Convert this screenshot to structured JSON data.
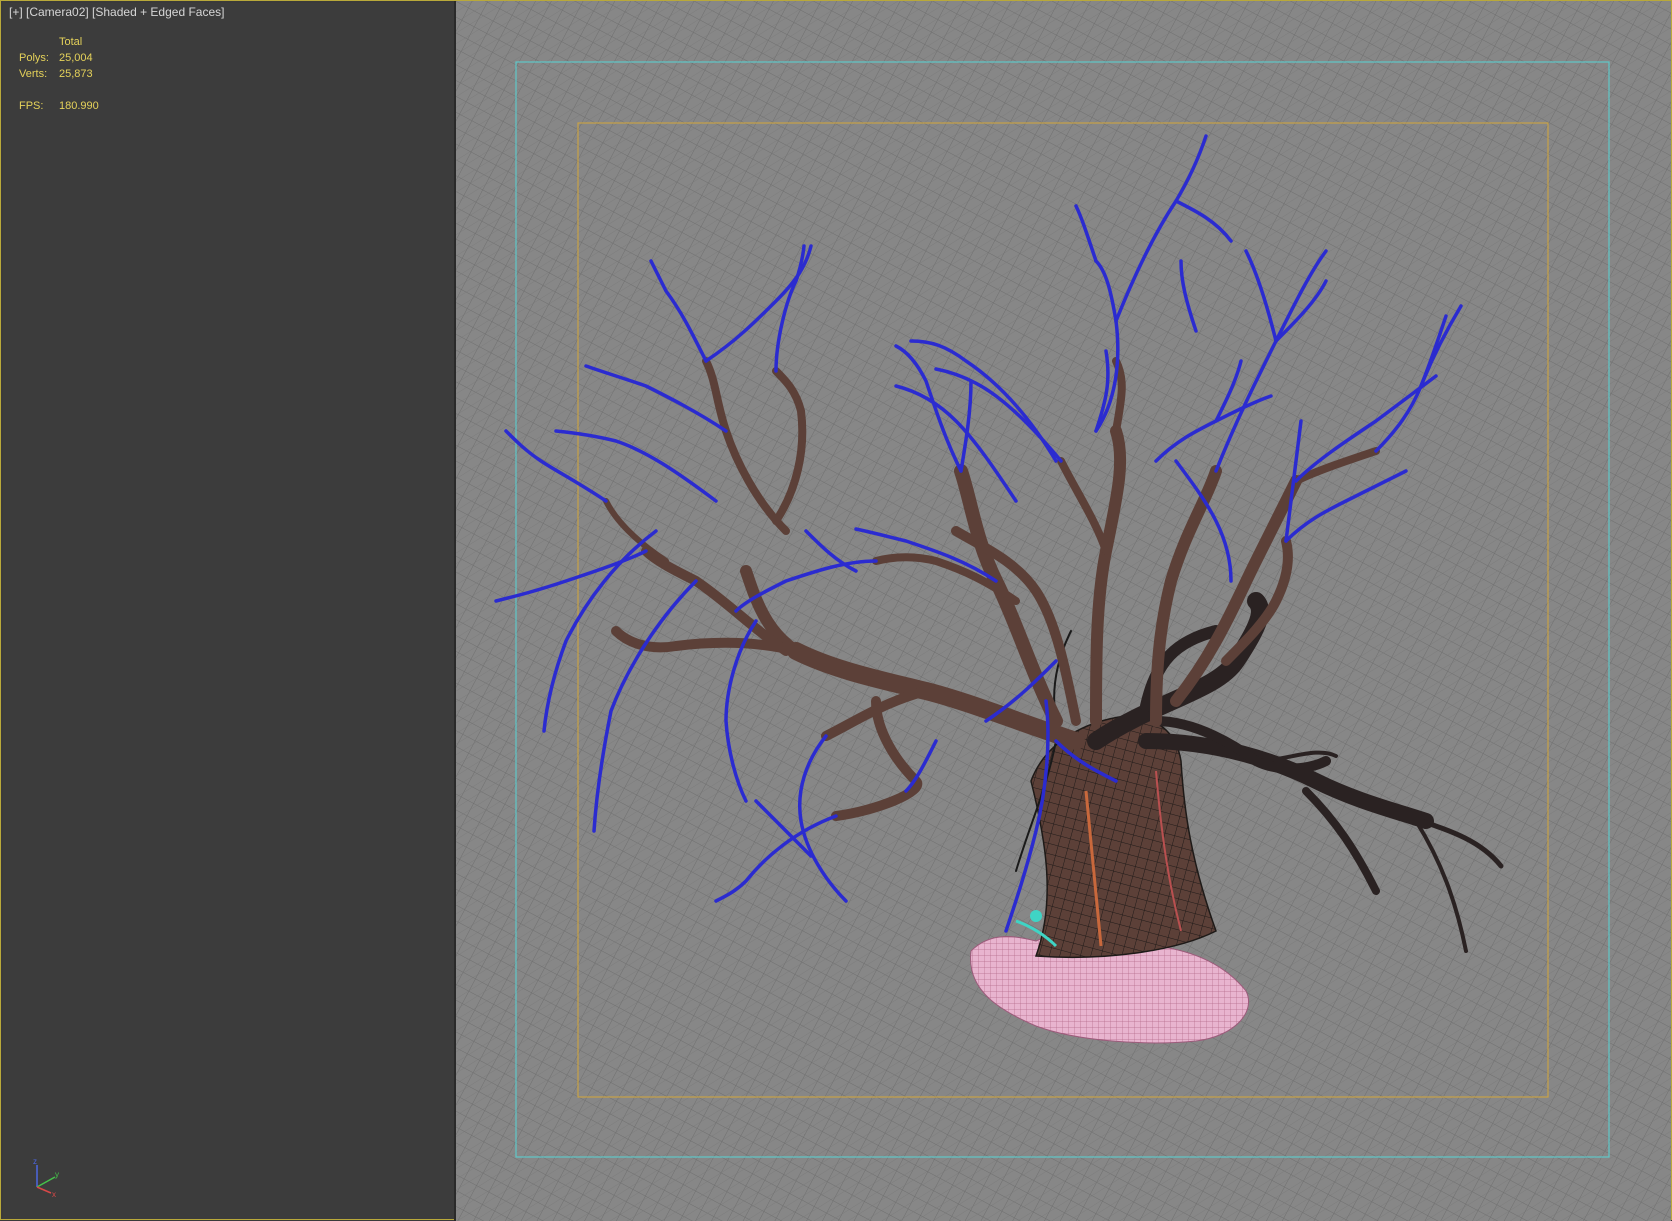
{
  "viewport": {
    "label_plus": "[+]",
    "label_camera": "[Camera02]",
    "label_mode": "[Shaded + Edged Faces]",
    "label_full": "[+] [Camera02] [Shaded + Edged Faces]"
  },
  "stats": {
    "header": "Total",
    "polys_label": "Polys:",
    "polys_value": "25,004",
    "verts_label": "Verts:",
    "verts_value": "25,873",
    "fps_label": "FPS:",
    "fps_value": "180.990"
  },
  "axis": {
    "z": "z",
    "y": "y",
    "x": "x"
  },
  "colors": {
    "stats_text": "#e5d25a",
    "label_text": "#d6d6d6",
    "safe_frame_outer": "#5fc7c9",
    "safe_frame_inner": "#c7a246",
    "branch_blue": "#2b2bd0",
    "bark": "#5a4038",
    "ground_pink": "#e7a7c8"
  }
}
